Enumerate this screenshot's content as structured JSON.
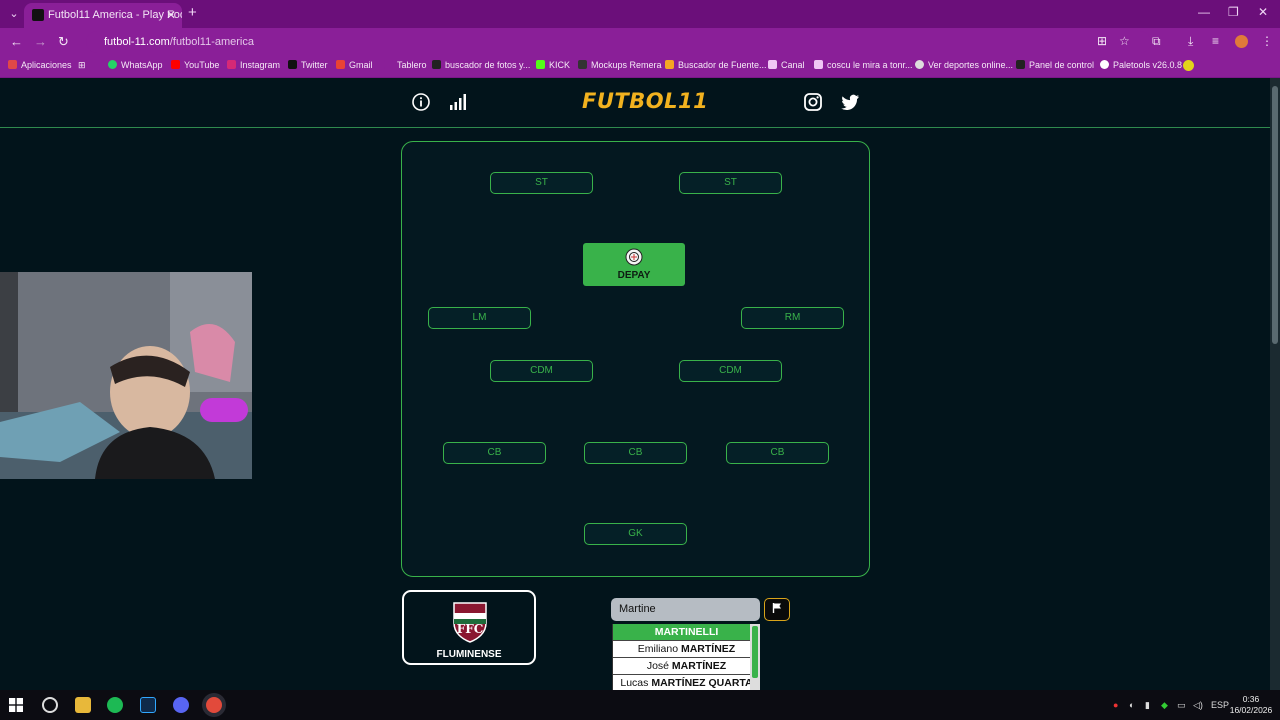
{
  "browser": {
    "tab_title": "Futbol11 America - Play Football",
    "url_host": "futbol-11.com",
    "url_path": "/futbol11-america",
    "bookmarks": [
      "Aplicaciones",
      "WhatsApp",
      "YouTube",
      "Instagram",
      "Twitter",
      "Gmail",
      "Tablero",
      "buscador de fotos y...",
      "KICK",
      "Mockups Remera",
      "Buscador de Fuente...",
      "Canal",
      "coscu le mira a tonr...",
      "Ver deportes online...",
      "Panel de control",
      "Paletools v26.0.8"
    ]
  },
  "header": {
    "logo": "FUTBOL11",
    "logo_color": "#f2b21f"
  },
  "pitch": {
    "accent": "#39b24a",
    "positions": {
      "st1": "ST",
      "st2": "ST",
      "lm": "LM",
      "rm": "RM",
      "cdm1": "CDM",
      "cdm2": "CDM",
      "cb1": "CB",
      "cb2": "CB",
      "cb3": "CB",
      "gk": "GK"
    },
    "filled_slot": {
      "player": "DEPAY",
      "club_icon": "corinthians-crest-icon"
    }
  },
  "club": {
    "name": "FLUMINENSE",
    "crest_icon": "fluminense-crest-icon"
  },
  "search": {
    "value": "Martine"
  },
  "suggestions": [
    {
      "first": "",
      "last": "MARTINELLI"
    },
    {
      "first": "Emiliano",
      "last": "MARTÍNEZ"
    },
    {
      "first": "José",
      "last": "MARTÍNEZ"
    },
    {
      "first": "Lucas",
      "last": "MARTÍNEZ QUARTA"
    }
  ],
  "taskbar": {
    "lang": "ESP",
    "time": "0:36",
    "date": "16/02/2026"
  }
}
